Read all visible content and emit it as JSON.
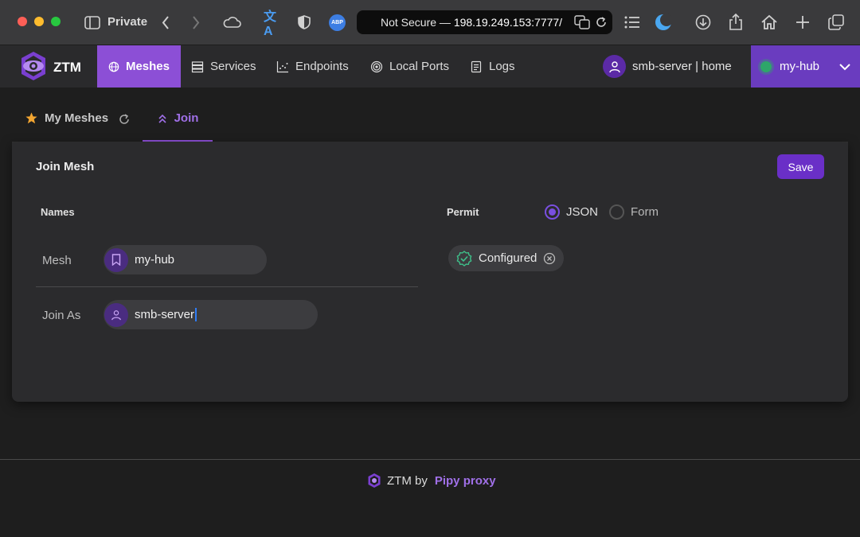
{
  "browser": {
    "private_label": "Private",
    "url_prefix": "Not Secure — ",
    "url_host": "198.19.249.153:7777/"
  },
  "app": {
    "brand": "ZTM",
    "nav": [
      {
        "label": "Meshes",
        "icon": "globe-icon",
        "active": true
      },
      {
        "label": "Services",
        "icon": "server-icon",
        "active": false
      },
      {
        "label": "Endpoints",
        "icon": "chart-icon",
        "active": false
      },
      {
        "label": "Local Ports",
        "icon": "target-icon",
        "active": false
      },
      {
        "label": "Logs",
        "icon": "document-icon",
        "active": false
      }
    ],
    "user": "smb-server | home",
    "hub": "my-hub"
  },
  "subtabs": {
    "my_meshes": "My Meshes",
    "join": "Join"
  },
  "form": {
    "title": "Join Mesh",
    "save_label": "Save",
    "names_label": "Names",
    "mesh_label": "Mesh",
    "mesh_value": "my-hub",
    "join_as_label": "Join As",
    "join_as_value": "smb-server",
    "permit_label": "Permit",
    "permit_options": [
      "JSON",
      "Form"
    ],
    "permit_selected": "JSON",
    "permit_status": "Configured"
  },
  "footer": {
    "prefix": "ZTM by",
    "brand": "Pipy proxy"
  },
  "colors": {
    "accent": "#8c4fd6",
    "accent_dark": "#6a2fc7",
    "success": "#3ec08a"
  }
}
